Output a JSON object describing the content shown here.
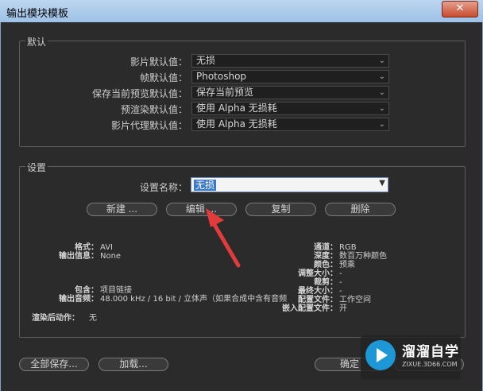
{
  "window": {
    "title": "输出模块模板",
    "close": "✕"
  },
  "defaults": {
    "title": "默认",
    "rows": [
      {
        "label": "影片默认值：",
        "value": "无损"
      },
      {
        "label": "帧默认值：",
        "value": "Photoshop"
      },
      {
        "label": "保存当前预览默认值：",
        "value": "保存当前预览"
      },
      {
        "label": "预渲染默认值：",
        "value": "使用 Alpha 无损耗"
      },
      {
        "label": "影片代理默认值：",
        "value": "使用 Alpha 无损耗"
      }
    ]
  },
  "settings": {
    "title": "设置",
    "name_label": "设置名称：",
    "name_value": "无损",
    "buttons": {
      "new": "新建 ...",
      "edit": "编辑 ...",
      "duplicate": "复制",
      "delete": "删除"
    },
    "info_left": [
      {
        "k": "格式：",
        "v": "AVI"
      },
      {
        "k": "输出信息：",
        "v": "None"
      },
      {
        "k": "包含：",
        "v": "项目链接"
      },
      {
        "k": "输出音频：",
        "v": "48.000 kHz / 16 bit / 立体声（如果合成中含有音频"
      }
    ],
    "info_right": [
      {
        "k": "通道：",
        "v": "RGB"
      },
      {
        "k": "深度：",
        "v": "数百万种颜色"
      },
      {
        "k": "颜色：",
        "v": "预乘"
      },
      {
        "k": "调整大小：",
        "v": "-"
      },
      {
        "k": "裁剪：",
        "v": "-"
      },
      {
        "k": "最终大小：",
        "v": "-"
      },
      {
        "k": "配置文件：",
        "v": "工作空间"
      },
      {
        "k": "嵌入配置文件：",
        "v": "开"
      }
    ],
    "post_render_label": "渲染后动作：",
    "post_render_value": "无"
  },
  "footer": {
    "save_all": "全部保存...",
    "load": "加载...",
    "ok": "确定",
    "cancel": ""
  },
  "watermark": {
    "name": "溜溜自学",
    "url": "ZIXUE.3D66.COM"
  },
  "colors": {
    "accent": "#3a78c9",
    "arrow": "#e23b3b",
    "brand": "#1d97d6"
  }
}
